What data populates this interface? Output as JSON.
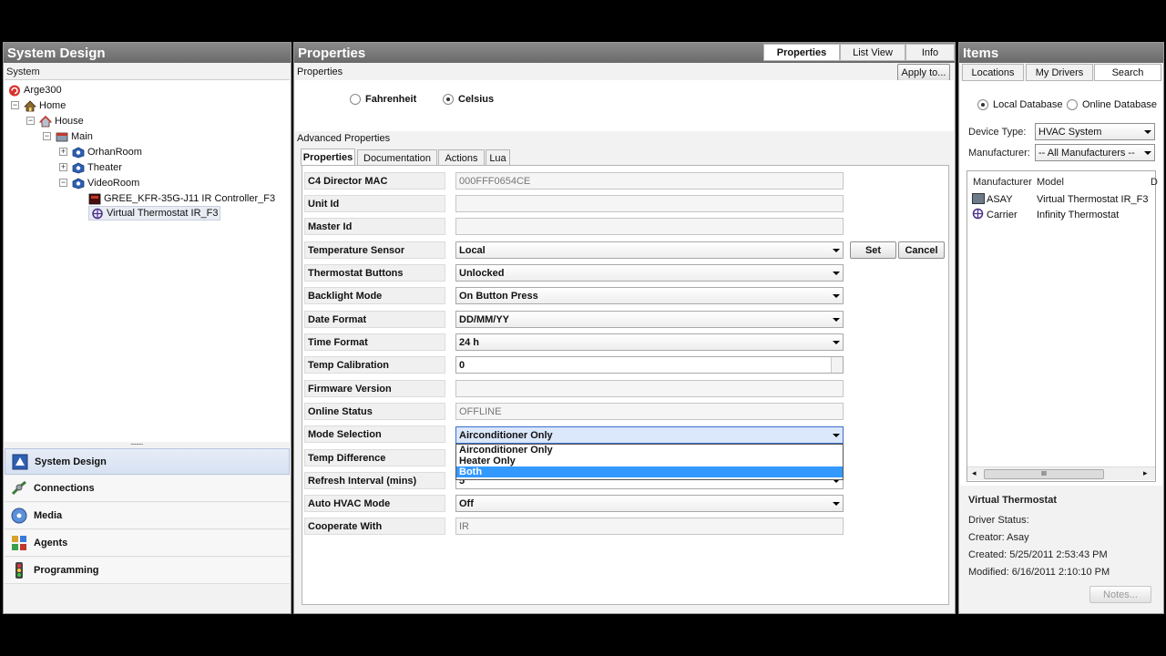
{
  "left": {
    "header": "System Design",
    "system_label": "System",
    "tree": [
      {
        "label": "Arge300"
      },
      {
        "label": "Home"
      },
      {
        "label": "House"
      },
      {
        "label": "Main"
      },
      {
        "label": "OrhanRoom"
      },
      {
        "label": "Theater"
      },
      {
        "label": "VideoRoom"
      },
      {
        "label": "GREE_KFR-35G-J11 IR Controller_F3"
      },
      {
        "label": "Virtual Thermostat IR_F3"
      }
    ],
    "nav": [
      {
        "label": "System Design"
      },
      {
        "label": "Connections"
      },
      {
        "label": "Media"
      },
      {
        "label": "Agents"
      },
      {
        "label": "Programming"
      }
    ],
    "splitter_dots": "........."
  },
  "center": {
    "header": "Properties",
    "tabs": [
      "Properties",
      "List View",
      "Info"
    ],
    "sub_label": "Properties",
    "apply_button": "Apply to...",
    "radio": {
      "fahrenheit": "Fahrenheit",
      "celsius": "Celsius"
    },
    "advanced_label": "Advanced Properties",
    "inner_tabs": [
      "Properties",
      "Documentation",
      "Actions",
      "Lua"
    ],
    "rows": [
      {
        "label": "C4 Director MAC",
        "value": "000FFF0654CE"
      },
      {
        "label": "Unit Id",
        "value": ""
      },
      {
        "label": "Master Id",
        "value": ""
      },
      {
        "label": "Temperature Sensor",
        "value": "Local"
      },
      {
        "label": "Thermostat Buttons",
        "value": "Unlocked"
      },
      {
        "label": "Backlight Mode",
        "value": "On Button Press"
      },
      {
        "label": "Date Format",
        "value": "DD/MM/YY"
      },
      {
        "label": "Time Format",
        "value": "24 h"
      },
      {
        "label": "Temp Calibration",
        "value": "0"
      },
      {
        "label": "Firmware Version",
        "value": ""
      },
      {
        "label": "Online Status",
        "value": "OFFLINE"
      },
      {
        "label": "Mode Selection",
        "value": "Airconditioner Only"
      },
      {
        "label": "Temp Difference",
        "value": ""
      },
      {
        "label": "Refresh Interval (mins)",
        "value": "5"
      },
      {
        "label": "Auto HVAC Mode",
        "value": "Off"
      },
      {
        "label": "Cooperate With",
        "value": "IR"
      }
    ],
    "set_button": "Set",
    "cancel_button": "Cancel",
    "mode_options": [
      "Airconditioner Only",
      "Heater Only",
      "Both"
    ]
  },
  "right": {
    "header": "Items",
    "tabs": [
      "Locations",
      "My Drivers",
      "Search"
    ],
    "db_local": "Local Database",
    "db_online": "Online Database",
    "device_type_label": "Device Type:",
    "device_type_value": "HVAC System",
    "manufacturer_label": "Manufacturer:",
    "manufacturer_value": "-- All Manufacturers --",
    "columns": [
      "Manufacturer",
      "Model",
      "D"
    ],
    "rows": [
      {
        "manufacturer": "ASAY",
        "model": "Virtual Thermostat IR_F3"
      },
      {
        "manufacturer": "Carrier",
        "model": "Infinity Thermostat"
      }
    ],
    "scroll_mark": "III",
    "detail_title": "Virtual Thermostat",
    "driver_status": "Driver Status:",
    "creator": "Creator: Asay",
    "created": "Created: 5/25/2011 2:53:43 PM",
    "modified": "Modified: 6/16/2011 2:10:10 PM",
    "notes_button": "Notes..."
  },
  "colors": {
    "accent": "#3399ff",
    "header": "#7a7a7a",
    "selection": "#dbe7fb"
  }
}
